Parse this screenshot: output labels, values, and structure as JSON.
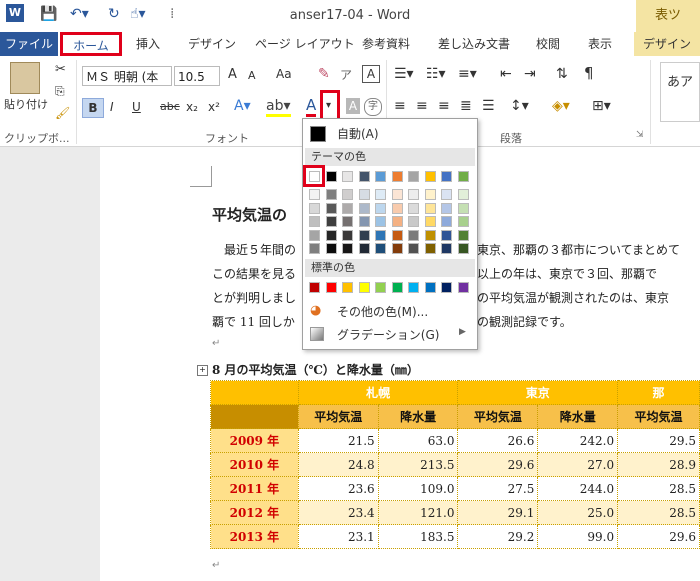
{
  "window": {
    "title": "anser17-04 - Word",
    "context_tab": "表ツ"
  },
  "tabs": [
    "ファイル",
    "ホーム",
    "挿入",
    "デザイン",
    "ページ レイアウト",
    "参考資料",
    "差し込み文書",
    "校閲",
    "表示",
    "デザイン"
  ],
  "ribbon": {
    "paste_label": "貼り付け",
    "clipboard_label": "クリップボ...",
    "font_name": "ＭＳ 明朝 (本",
    "font_size": "10.5",
    "font_group_label": "フォント",
    "paragraph_group_label": "段落",
    "style_preview": "あア",
    "font_grow": "A",
    "font_shrink": "A",
    "case_label": "Aa",
    "bold": "B",
    "italic": "I",
    "underline": "U",
    "strike": "abc",
    "sub": "x₂",
    "sup": "x²",
    "font_color_letter": "A"
  },
  "popup": {
    "auto_label": "自動(A)",
    "theme_header": "テーマの色",
    "standard_header": "標準の色",
    "more_colors": "その他の色(M)...",
    "gradient": "グラデーション(G)",
    "theme_top": [
      "#ffffff",
      "#000000",
      "#e7e6e6",
      "#44546a",
      "#5b9bd5",
      "#ed7d31",
      "#a5a5a5",
      "#ffc000",
      "#4472c4",
      "#70ad47"
    ],
    "theme_shades": [
      [
        "#f2f2f2",
        "#7f7f7f",
        "#d0cece",
        "#d6dce4",
        "#deebf6",
        "#fbe5d5",
        "#ededed",
        "#fff2cc",
        "#dae3f3",
        "#e2efd9"
      ],
      [
        "#d8d8d8",
        "#595959",
        "#aeabab",
        "#adb9ca",
        "#bdd7ee",
        "#f8cbad",
        "#dbdbdb",
        "#fee599",
        "#b4c6e7",
        "#c5e0b3"
      ],
      [
        "#bfbfbf",
        "#3f3f3f",
        "#757070",
        "#8496b0",
        "#9cc3e5",
        "#f4b183",
        "#c9c9c9",
        "#ffd965",
        "#8eaadb",
        "#a8d08d"
      ],
      [
        "#a5a5a5",
        "#262626",
        "#3a3838",
        "#323f4f",
        "#2e75b5",
        "#c55a11",
        "#7b7b7b",
        "#bf9000",
        "#2f5496",
        "#538135"
      ],
      [
        "#7f7f7f",
        "#0c0c0c",
        "#171616",
        "#222a35",
        "#1e4e79",
        "#833c0b",
        "#525252",
        "#7f6000",
        "#1f3864",
        "#375623"
      ]
    ],
    "standard": [
      "#c00000",
      "#ff0000",
      "#ffc000",
      "#ffff00",
      "#92d050",
      "#00b050",
      "#00b0f0",
      "#0070c0",
      "#002060",
      "#7030a0"
    ]
  },
  "doc": {
    "heading": "平均気温の",
    "para_lines": [
      "　最近５年間の",
      "この結果を見る",
      "とが判明しまし",
      "覇で 11 回しか"
    ],
    "para_right": [
      "東京、那覇の３都市についてまとめて",
      "以上の年は、東京で３回、那覇で",
      "の平均気温が観測されたのは、東京",
      "の観測記録です。"
    ],
    "table_title": "8 月の平均気温（℃）と降水量（㎜）",
    "cities": [
      "札幌",
      "東京",
      "那"
    ],
    "sub_headers": [
      "平均気温",
      "降水量",
      "平均気温",
      "降水量",
      "平均気温"
    ],
    "rows": [
      {
        "year": "2009 年",
        "v": [
          "21.5",
          "63.0",
          "26.6",
          "242.0",
          "29.5"
        ]
      },
      {
        "year": "2010 年",
        "v": [
          "24.8",
          "213.5",
          "29.6",
          "27.0",
          "28.9"
        ]
      },
      {
        "year": "2011 年",
        "v": [
          "23.6",
          "109.0",
          "27.5",
          "244.0",
          "28.5"
        ]
      },
      {
        "year": "2012 年",
        "v": [
          "23.4",
          "121.0",
          "29.1",
          "25.0",
          "28.5"
        ]
      },
      {
        "year": "2013 年",
        "v": [
          "23.1",
          "183.5",
          "29.2",
          "99.0",
          "29.6"
        ]
      }
    ]
  }
}
